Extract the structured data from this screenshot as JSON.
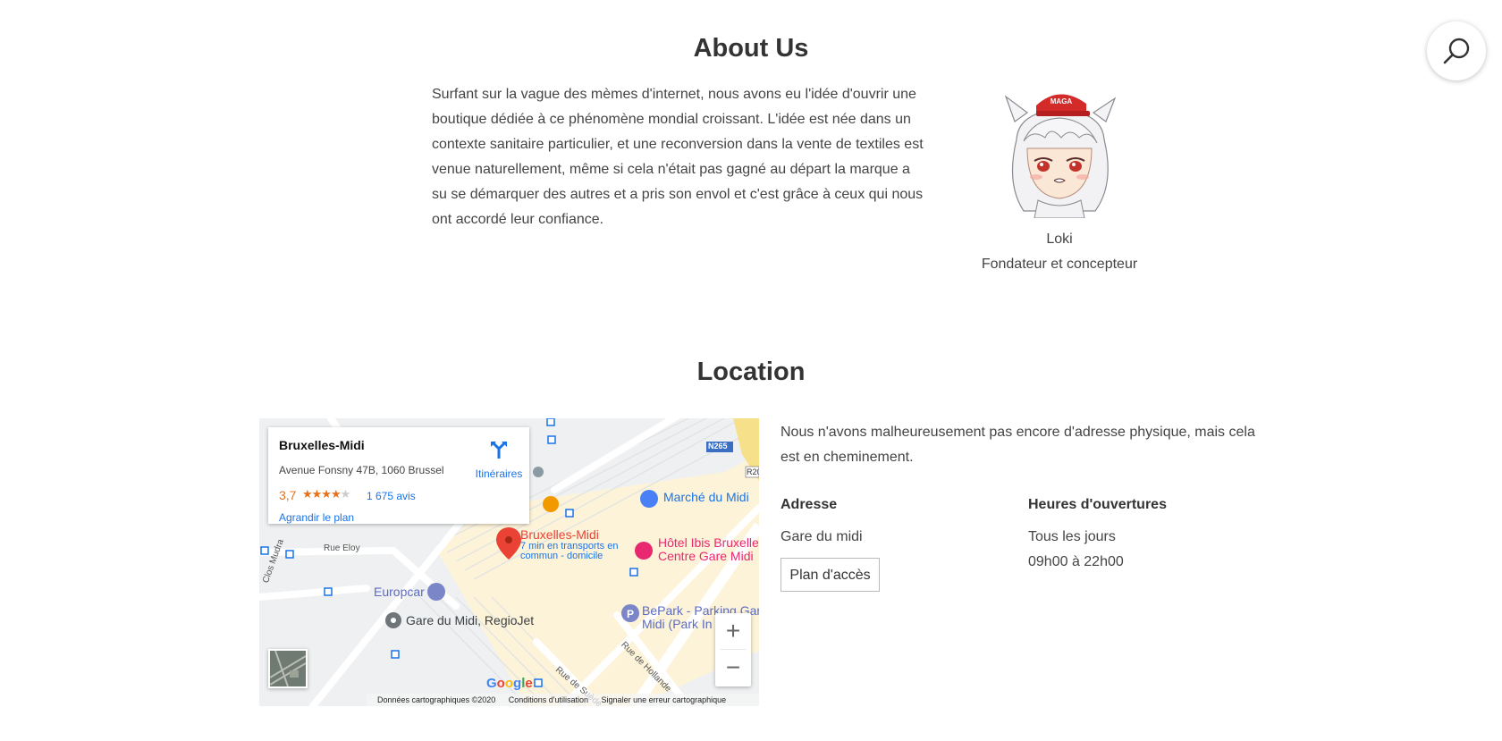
{
  "about": {
    "title": "About Us",
    "text": "Surfant sur la vague des mèmes d'internet, nous avons eu l'idée d'ouvrir une boutique dédiée à ce phénomène mondial croissant. L'idée est née dans un contexte sanitaire particulier, et une reconversion dans la vente de textiles est venue naturellement, même si cela n'était pas gagné au départ la marque a su se démarquer des autres et a pris son envol et c'est grâce à ceux qui nous ont accordé leur confiance.",
    "founder_name": "Loki",
    "founder_role": "Fondateur et concepteur",
    "avatar_cap_text": "MAGA"
  },
  "location": {
    "title": "Location",
    "text": "Nous n'avons malheureusement pas encore d'adresse physique, mais cela est en cheminement.",
    "address_heading": "Adresse",
    "address_value": "Gare du midi",
    "plan_button": "Plan d'accès",
    "hours_heading": "Heures d'ouvertures",
    "hours_days": "Tous les jours",
    "hours_time": "09h00 à 22h00"
  },
  "map": {
    "place_name": "Bruxelles-Midi",
    "place_address": "Avenue Fonsny 47B, 1060 Brussel",
    "rating": "3,7",
    "stars_rating": 3.7,
    "reviews": "1 675 avis",
    "enlarge": "Agrandir le plan",
    "directions": "Itinéraires",
    "labels": {
      "marche": "Marché du Midi",
      "ibis_1": "Hôtel Ibis Bruxelle",
      "ibis_2": "Centre Gare Midi",
      "station": "Bruxelles-Midi",
      "transit_1": "7 min en transports en",
      "transit_2": "commun - domicile",
      "europcar": "Europcar",
      "gare": "Gare du Midi, RegioJet",
      "bepark_1": "BePark - Parking Gar",
      "bepark_2": "Midi (Park In",
      "rue_eloy": "Rue Eloy",
      "clos_mudra": "Clos Mudra",
      "rue_hollande": "Rue de Hollande",
      "rue_suede": "Rue de Suède",
      "n265": "N265",
      "r20": "R20"
    },
    "zoom_in": "+",
    "zoom_out": "−",
    "google": "Google",
    "footer_data": "Données cartographiques ©2020",
    "footer_terms": "Conditions d'utilisation",
    "footer_report": "Signaler une erreur cartographique"
  },
  "colors": {
    "link": "#1a73e8",
    "rating": "#e7711b",
    "pin": "#ea4335",
    "hotel": "#e8286f",
    "poi": "#4a80f5"
  }
}
